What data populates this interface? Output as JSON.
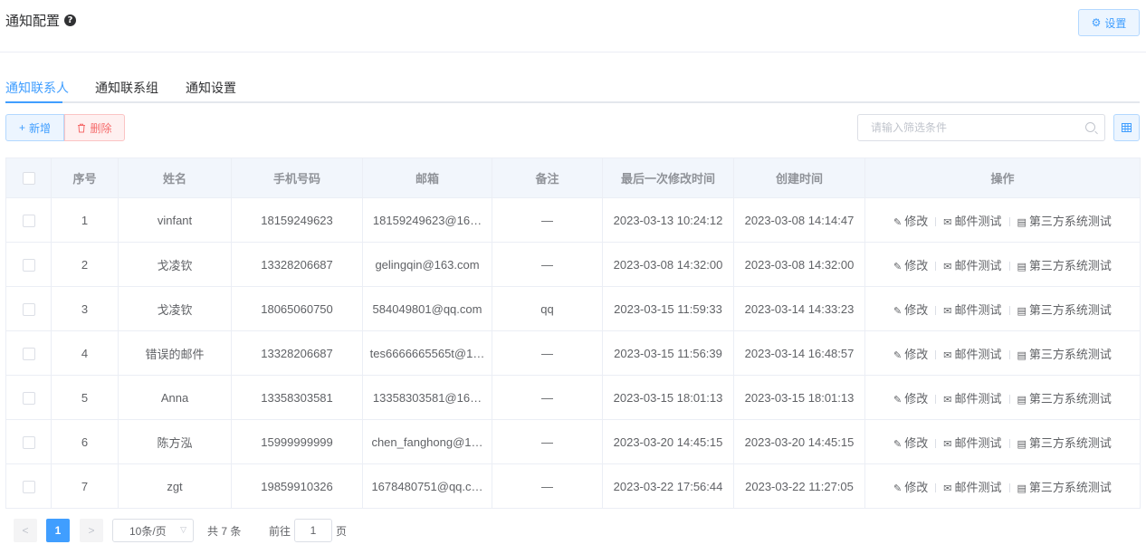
{
  "header": {
    "title": "通知配置",
    "help_icon": "?",
    "settings_label": "设置",
    "settings_icon": "⚙"
  },
  "tabs": [
    {
      "label": "通知联系人",
      "active": true
    },
    {
      "label": "通知联系组",
      "active": false
    },
    {
      "label": "通知设置",
      "active": false
    }
  ],
  "toolbar": {
    "add_icon": "+",
    "add_label": "新增",
    "delete_label": "删除",
    "search_placeholder": "请输入筛选条件"
  },
  "table": {
    "columns": [
      "序号",
      "姓名",
      "手机号码",
      "邮箱",
      "备注",
      "最后一次修改时间",
      "创建时间",
      "操作"
    ],
    "rows": [
      {
        "index": "1",
        "name": "vinfant",
        "phone": "18159249623",
        "email": "18159249623@16…",
        "note": "—",
        "modified": "2023-03-13 10:24:12",
        "created": "2023-03-08 14:14:47"
      },
      {
        "index": "2",
        "name": "戈凌钦",
        "phone": "13328206687",
        "email": "gelingqin@163.com",
        "note": "—",
        "modified": "2023-03-08 14:32:00",
        "created": "2023-03-08 14:32:00"
      },
      {
        "index": "3",
        "name": "戈凌钦",
        "phone": "18065060750",
        "email": "584049801@qq.com",
        "note": "qq",
        "modified": "2023-03-15 11:59:33",
        "created": "2023-03-14 14:33:23"
      },
      {
        "index": "4",
        "name": "错误的邮件",
        "phone": "13328206687",
        "email": "tes6666665565t@1…",
        "note": "—",
        "modified": "2023-03-15 11:56:39",
        "created": "2023-03-14 16:48:57"
      },
      {
        "index": "5",
        "name": "Anna",
        "phone": "13358303581",
        "email": "13358303581@16…",
        "note": "—",
        "modified": "2023-03-15 18:01:13",
        "created": "2023-03-15 18:01:13"
      },
      {
        "index": "6",
        "name": "陈方泓",
        "phone": "15999999999",
        "email": "chen_fanghong@1…",
        "note": "—",
        "modified": "2023-03-20 14:45:15",
        "created": "2023-03-20 14:45:15"
      },
      {
        "index": "7",
        "name": "zgt",
        "phone": "19859910326",
        "email": "1678480751@qq.c…",
        "note": "—",
        "modified": "2023-03-22 17:56:44",
        "created": "2023-03-22 11:27:05"
      }
    ],
    "actions": {
      "edit_label": "修改",
      "email_test_label": "邮件测试",
      "third_party_label": "第三方系统测试"
    }
  },
  "pagination": {
    "prev": "<",
    "next": ">",
    "current_page": "1",
    "page_size": "10条/页",
    "total": "共 7 条",
    "goto_label": "前往",
    "goto_value": "1",
    "page_suffix": "页"
  },
  "colors": {
    "primary": "#409eff",
    "danger": "#f56c6c",
    "header_bg": "#f2f6fc",
    "border": "#ebeef5"
  }
}
